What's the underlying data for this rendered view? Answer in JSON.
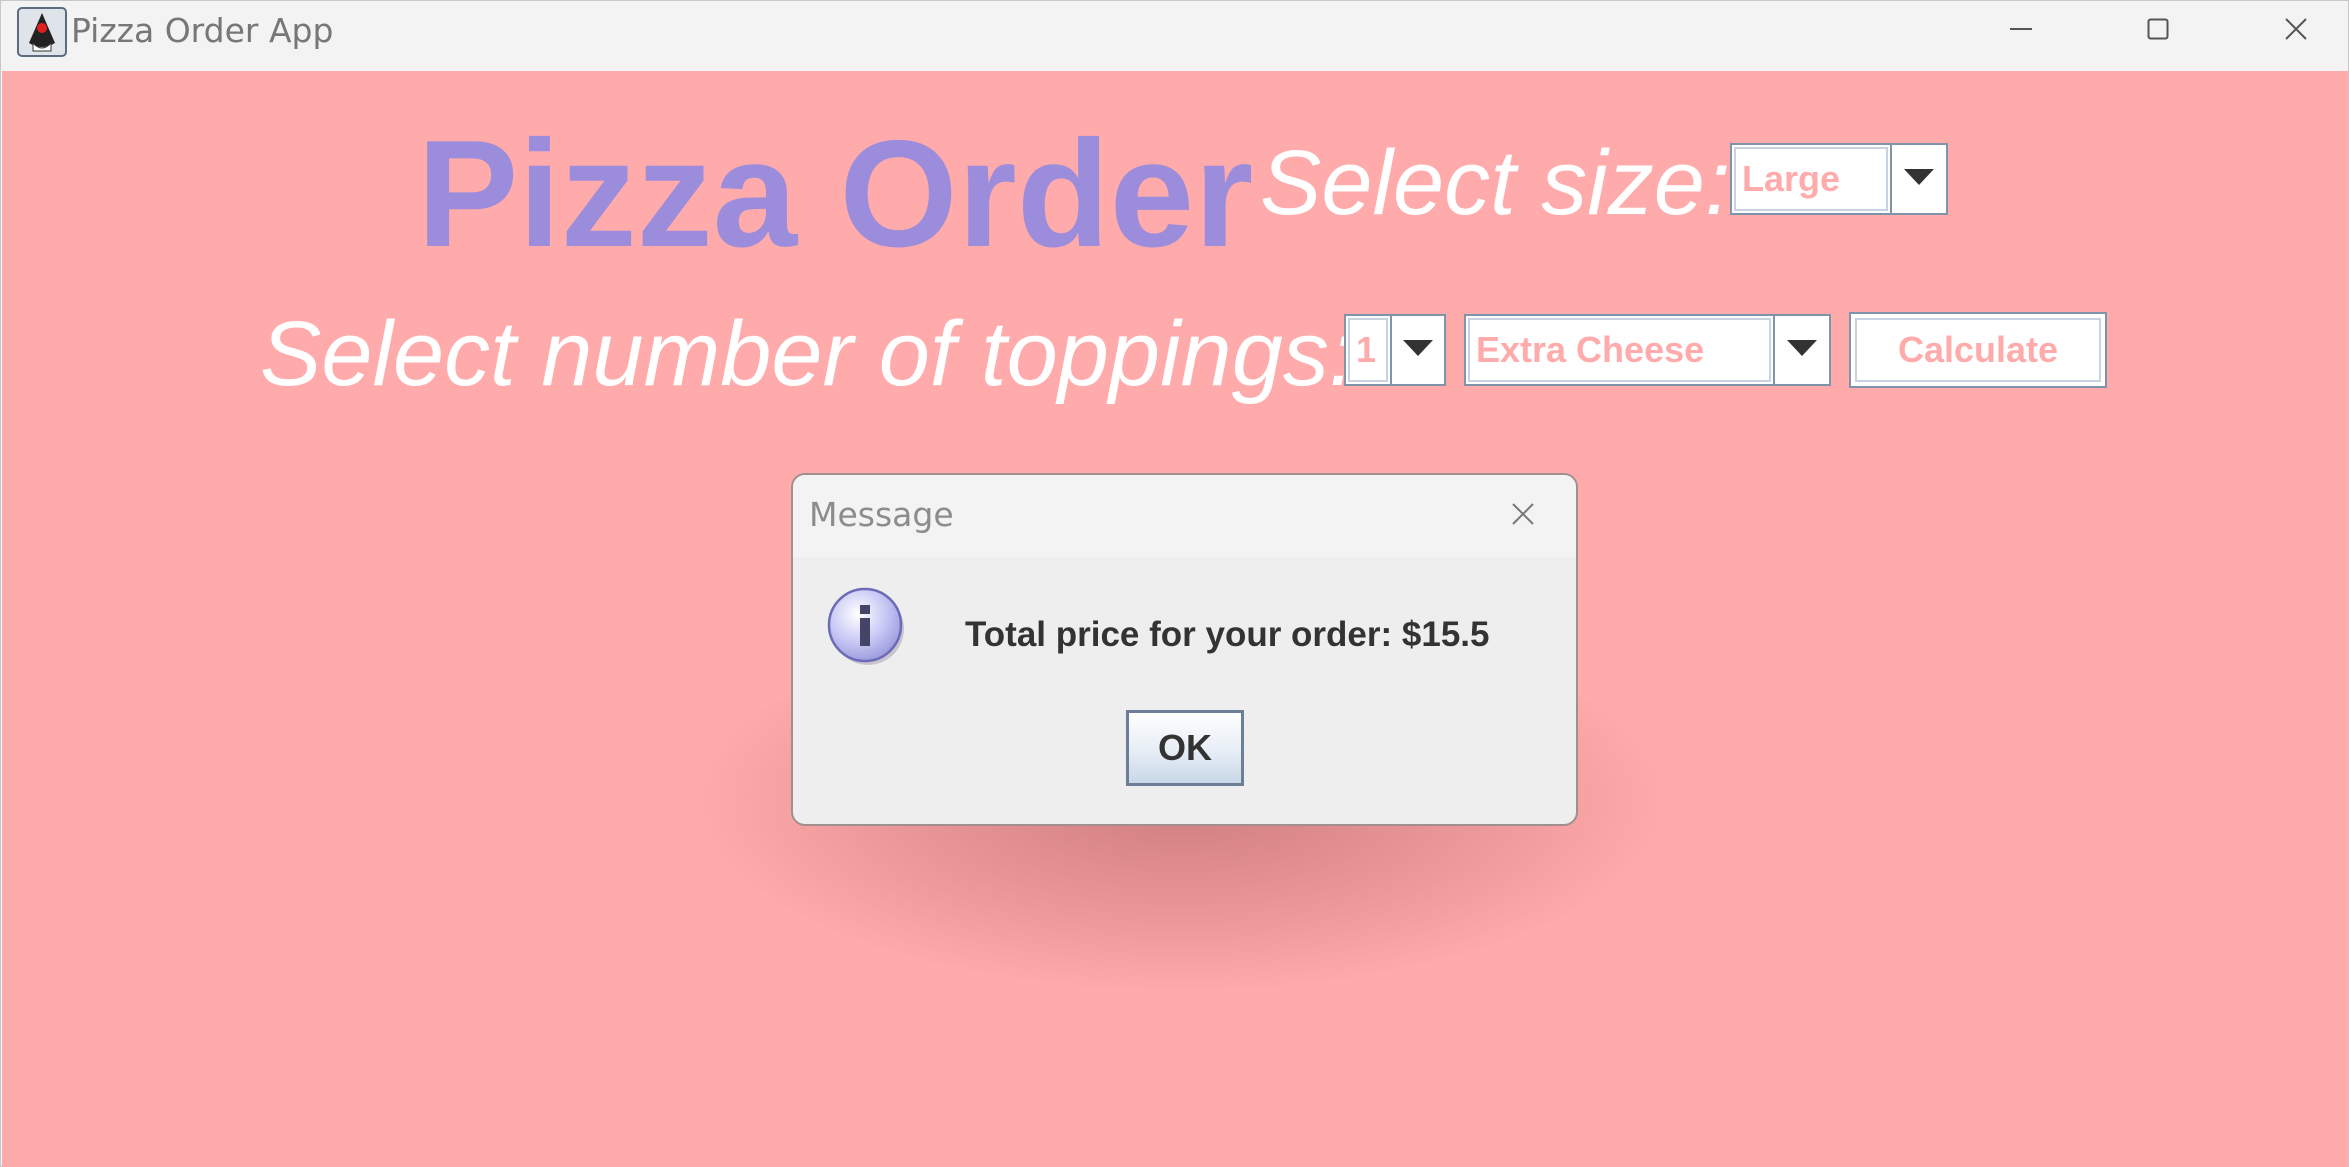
{
  "window": {
    "title": "Pizza Order App",
    "icons": {
      "app": "java-duke-icon",
      "minimize": "minimize-icon",
      "maximize": "maximize-icon",
      "close": "close-icon"
    }
  },
  "main": {
    "heading": "Pizza Order",
    "size_label": "Select size:",
    "size_selected": "Large",
    "toppings_label": "Select number of toppings:",
    "toppings_count_selected": "1",
    "topping_selected": "Extra Cheese",
    "calculate_label": "Calculate"
  },
  "dialog": {
    "title": "Message",
    "message": "Total price for your order: $15.5",
    "ok_label": "OK",
    "icons": {
      "info": "info-icon",
      "close": "close-icon"
    }
  },
  "colors": {
    "background": "#ffaaab",
    "heading": "#9b8ddb",
    "label_text": "#ffffff",
    "field_text": "#ffaaab",
    "dialog_bg": "#eeeeee"
  }
}
